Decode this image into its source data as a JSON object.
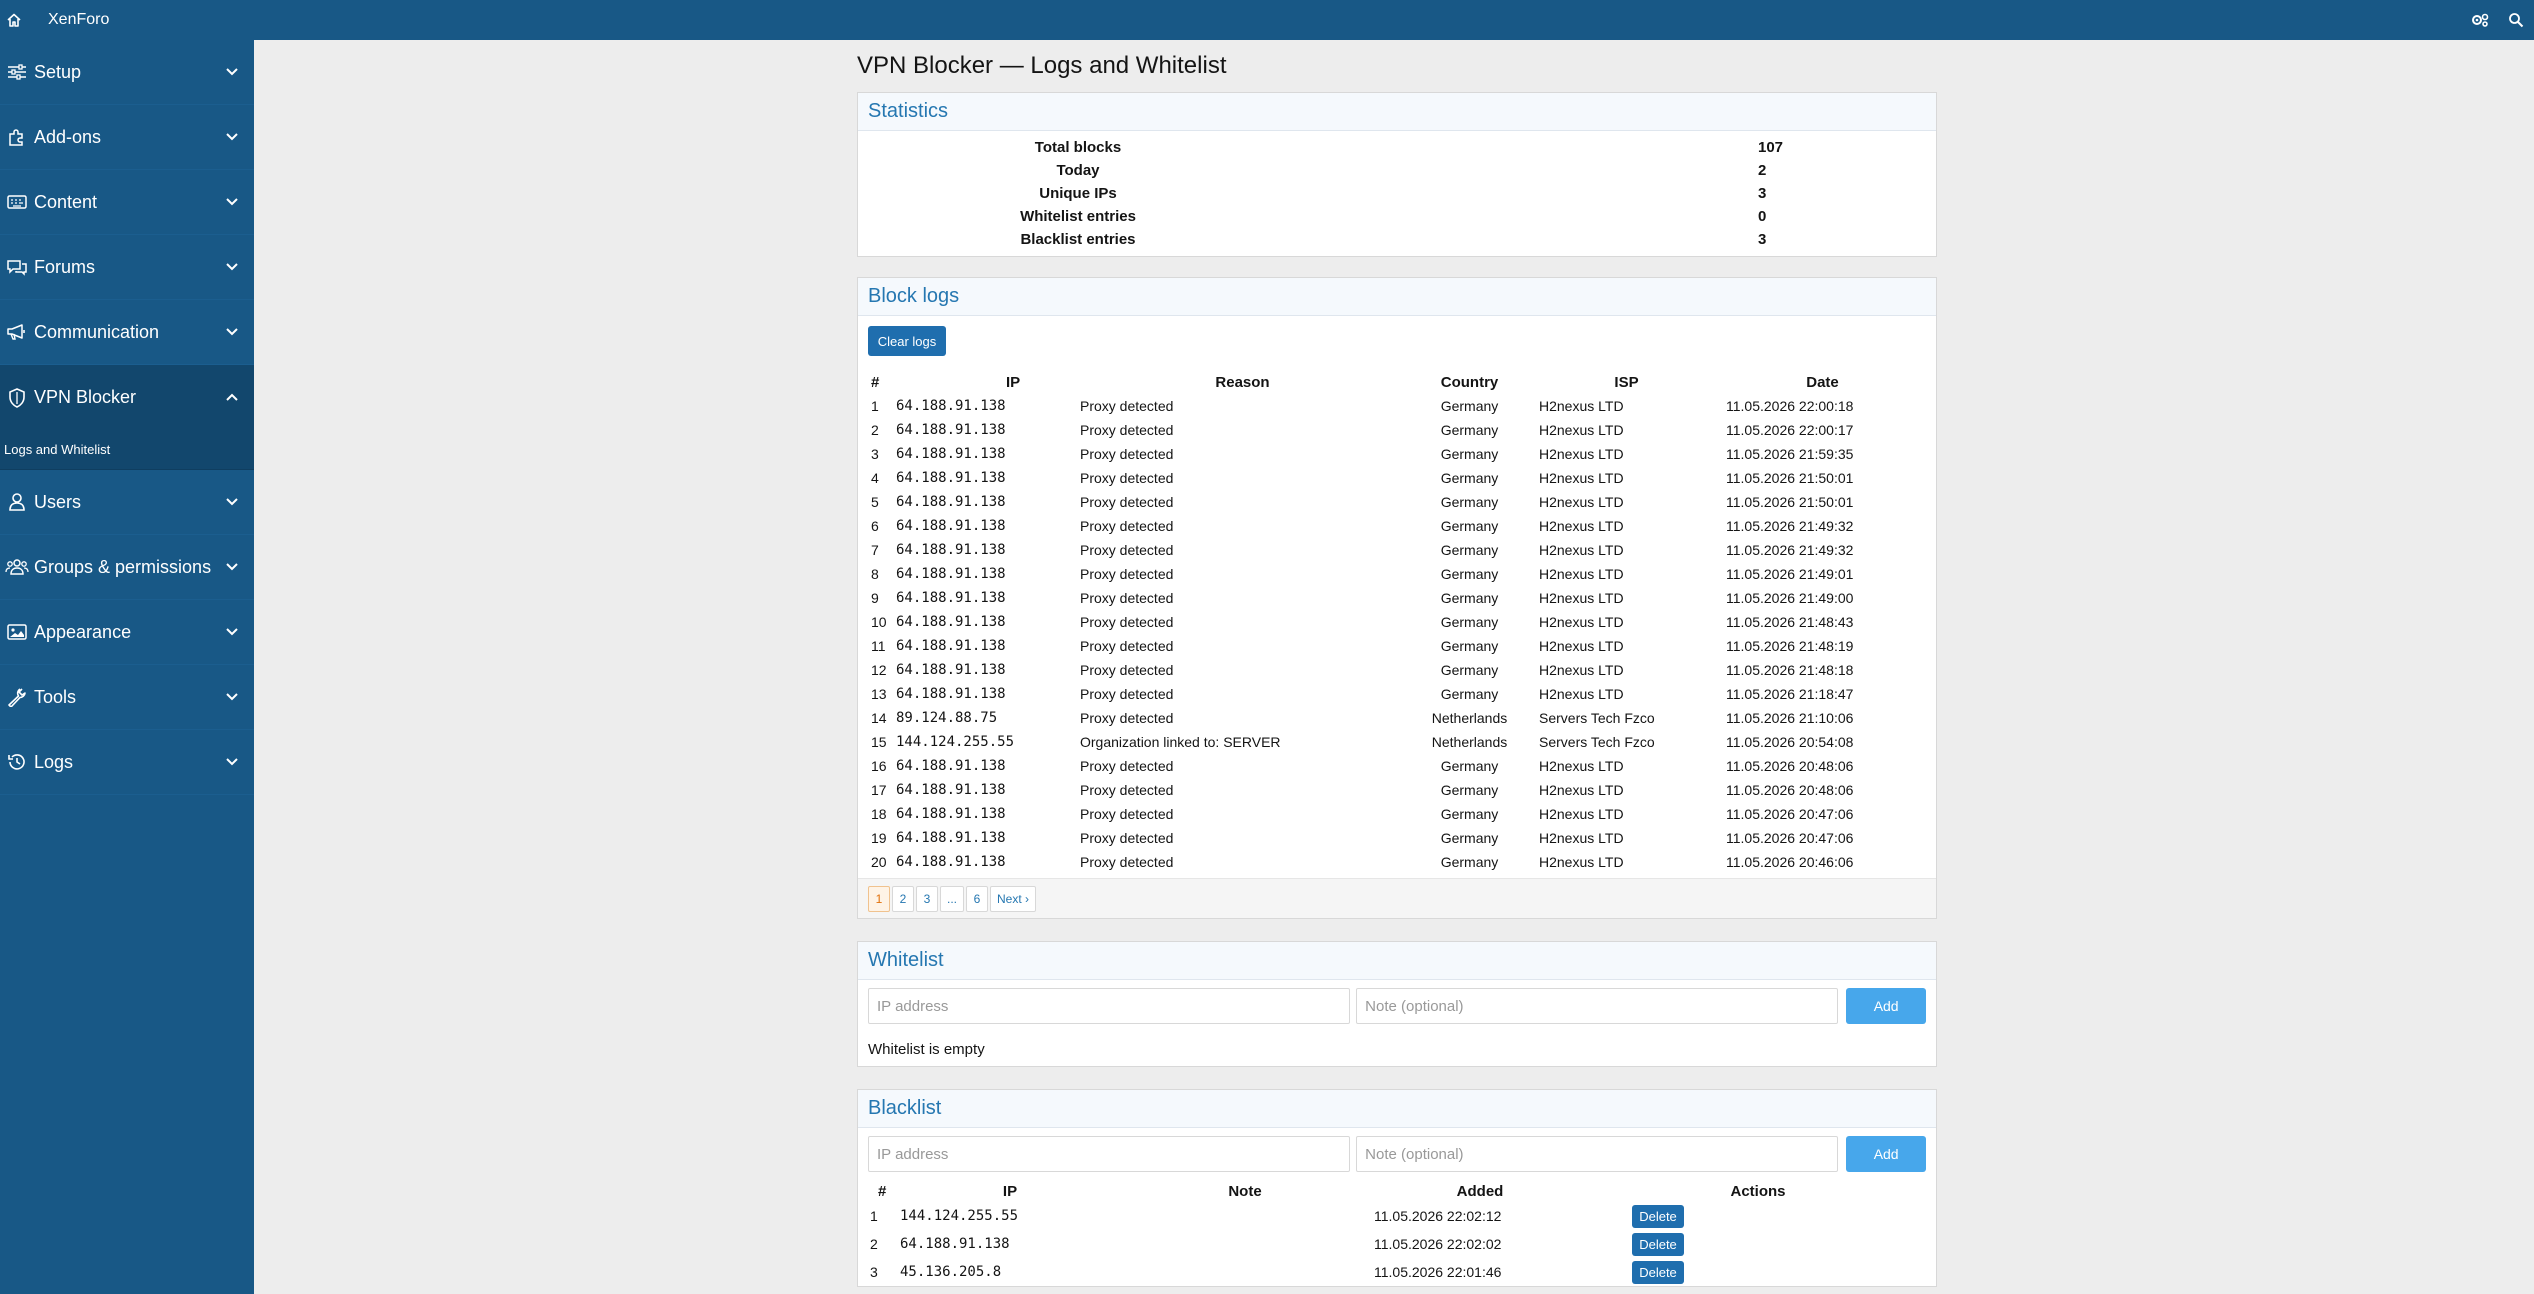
{
  "topbar": {
    "brand": "XenForo",
    "home_icon": "home-icon",
    "right_icons": [
      "settings-cog-icon",
      "search-icon"
    ]
  },
  "sidebar": {
    "items": [
      {
        "label": "Setup",
        "icon": "sliders-icon"
      },
      {
        "label": "Add-ons",
        "icon": "puzzle-icon"
      },
      {
        "label": "Content",
        "icon": "keyboard-icon"
      },
      {
        "label": "Forums",
        "icon": "comments-icon"
      },
      {
        "label": "Communication",
        "icon": "megaphone-icon"
      },
      {
        "label": "VPN Blocker",
        "icon": "shield-icon",
        "active": true
      },
      {
        "label": "Users",
        "icon": "user-icon"
      },
      {
        "label": "Groups & permissions",
        "icon": "users-icon"
      },
      {
        "label": "Appearance",
        "icon": "image-icon"
      },
      {
        "label": "Tools",
        "icon": "wrench-icon"
      },
      {
        "label": "Logs",
        "icon": "history-icon"
      }
    ],
    "subitem": "Logs and Whitelist"
  },
  "page": {
    "title": "VPN Blocker — Logs and Whitelist"
  },
  "statistics": {
    "title": "Statistics",
    "rows": [
      {
        "label": "Total blocks",
        "value": "107"
      },
      {
        "label": "Today",
        "value": "2"
      },
      {
        "label": "Unique IPs",
        "value": "3"
      },
      {
        "label": "Whitelist entries",
        "value": "0"
      },
      {
        "label": "Blacklist entries",
        "value": "3"
      }
    ]
  },
  "block_logs": {
    "title": "Block logs",
    "clear_label": "Clear logs",
    "headers": [
      "#",
      "IP",
      "Reason",
      "Country",
      "ISP",
      "Date"
    ],
    "rows": [
      [
        "1",
        "64.188.91.138",
        "Proxy detected",
        "Germany",
        "H2nexus LTD",
        "11.05.2026 22:00:18"
      ],
      [
        "2",
        "64.188.91.138",
        "Proxy detected",
        "Germany",
        "H2nexus LTD",
        "11.05.2026 22:00:17"
      ],
      [
        "3",
        "64.188.91.138",
        "Proxy detected",
        "Germany",
        "H2nexus LTD",
        "11.05.2026 21:59:35"
      ],
      [
        "4",
        "64.188.91.138",
        "Proxy detected",
        "Germany",
        "H2nexus LTD",
        "11.05.2026 21:50:01"
      ],
      [
        "5",
        "64.188.91.138",
        "Proxy detected",
        "Germany",
        "H2nexus LTD",
        "11.05.2026 21:50:01"
      ],
      [
        "6",
        "64.188.91.138",
        "Proxy detected",
        "Germany",
        "H2nexus LTD",
        "11.05.2026 21:49:32"
      ],
      [
        "7",
        "64.188.91.138",
        "Proxy detected",
        "Germany",
        "H2nexus LTD",
        "11.05.2026 21:49:32"
      ],
      [
        "8",
        "64.188.91.138",
        "Proxy detected",
        "Germany",
        "H2nexus LTD",
        "11.05.2026 21:49:01"
      ],
      [
        "9",
        "64.188.91.138",
        "Proxy detected",
        "Germany",
        "H2nexus LTD",
        "11.05.2026 21:49:00"
      ],
      [
        "10",
        "64.188.91.138",
        "Proxy detected",
        "Germany",
        "H2nexus LTD",
        "11.05.2026 21:48:43"
      ],
      [
        "11",
        "64.188.91.138",
        "Proxy detected",
        "Germany",
        "H2nexus LTD",
        "11.05.2026 21:48:19"
      ],
      [
        "12",
        "64.188.91.138",
        "Proxy detected",
        "Germany",
        "H2nexus LTD",
        "11.05.2026 21:48:18"
      ],
      [
        "13",
        "64.188.91.138",
        "Proxy detected",
        "Germany",
        "H2nexus LTD",
        "11.05.2026 21:18:47"
      ],
      [
        "14",
        "89.124.88.75",
        "Proxy detected",
        "Netherlands",
        "Servers Tech Fzco",
        "11.05.2026 21:10:06"
      ],
      [
        "15",
        "144.124.255.55",
        "Organization linked to: SERVER",
        "Netherlands",
        "Servers Tech Fzco",
        "11.05.2026 20:54:08"
      ],
      [
        "16",
        "64.188.91.138",
        "Proxy detected",
        "Germany",
        "H2nexus LTD",
        "11.05.2026 20:48:06"
      ],
      [
        "17",
        "64.188.91.138",
        "Proxy detected",
        "Germany",
        "H2nexus LTD",
        "11.05.2026 20:48:06"
      ],
      [
        "18",
        "64.188.91.138",
        "Proxy detected",
        "Germany",
        "H2nexus LTD",
        "11.05.2026 20:47:06"
      ],
      [
        "19",
        "64.188.91.138",
        "Proxy detected",
        "Germany",
        "H2nexus LTD",
        "11.05.2026 20:47:06"
      ],
      [
        "20",
        "64.188.91.138",
        "Proxy detected",
        "Germany",
        "H2nexus LTD",
        "11.05.2026 20:46:06"
      ]
    ],
    "pagination": {
      "pages": [
        "1",
        "2",
        "3",
        "...",
        "6"
      ],
      "current": "1",
      "next_label": "Next ›"
    }
  },
  "whitelist": {
    "title": "Whitelist",
    "ip_placeholder": "IP address",
    "note_placeholder": "Note (optional)",
    "add_label": "Add",
    "empty_text": "Whitelist is empty"
  },
  "blacklist": {
    "title": "Blacklist",
    "ip_placeholder": "IP address",
    "note_placeholder": "Note (optional)",
    "add_label": "Add",
    "headers": [
      "#",
      "IP",
      "Note",
      "Added",
      "Actions"
    ],
    "delete_label": "Delete",
    "rows": [
      [
        "1",
        "144.124.255.55",
        "",
        "11.05.2026 22:02:12"
      ],
      [
        "2",
        "64.188.91.138",
        "",
        "11.05.2026 22:02:02"
      ],
      [
        "3",
        "45.136.205.8",
        "",
        "11.05.2026 22:01:46"
      ]
    ]
  },
  "colors": {
    "brand": "#185886",
    "link": "#2577b1",
    "button": "#1f6eae",
    "add_button": "#47a7eb"
  }
}
